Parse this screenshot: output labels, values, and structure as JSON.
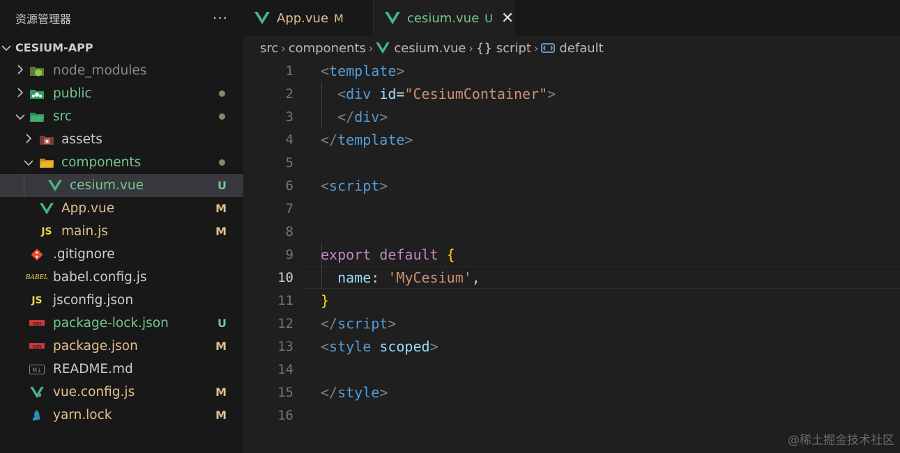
{
  "sidebar": {
    "title": "资源管理器",
    "more": "···",
    "root": {
      "chevron": "⌄",
      "label": "CESIUM-APP"
    },
    "items": [
      {
        "name": "node_modules",
        "kind": "folder",
        "depth": 1,
        "expanded": false,
        "icon": "node-folder-icon",
        "color": "#8b8b8b",
        "status": ""
      },
      {
        "name": "public",
        "kind": "folder",
        "depth": 1,
        "expanded": false,
        "icon": "public-folder-icon",
        "color": "#73c991",
        "status": "dot"
      },
      {
        "name": "src",
        "kind": "folder",
        "depth": 1,
        "expanded": true,
        "icon": "src-folder-icon",
        "color": "#73c991",
        "status": "dot"
      },
      {
        "name": "assets",
        "kind": "folder",
        "depth": 2,
        "expanded": false,
        "icon": "assets-folder-icon",
        "color": "#cccccc",
        "status": ""
      },
      {
        "name": "components",
        "kind": "folder",
        "depth": 2,
        "expanded": true,
        "icon": "components-folder-icon",
        "color": "#73c991",
        "status": "dot"
      },
      {
        "name": "cesium.vue",
        "kind": "file",
        "depth": 3,
        "icon": "vue-icon",
        "color": "#73c991",
        "status": "U",
        "selected": true
      },
      {
        "name": "App.vue",
        "kind": "file",
        "depth": 2,
        "icon": "vue-icon",
        "color": "#e2c08d",
        "status": "M"
      },
      {
        "name": "main.js",
        "kind": "file",
        "depth": 2,
        "icon": "js-icon",
        "color": "#e2c08d",
        "status": "M"
      },
      {
        "name": ".gitignore",
        "kind": "file",
        "depth": 1,
        "icon": "git-icon",
        "color": "#cccccc",
        "status": ""
      },
      {
        "name": "babel.config.js",
        "kind": "file",
        "depth": 1,
        "icon": "babel-icon",
        "color": "#cccccc",
        "status": ""
      },
      {
        "name": "jsconfig.json",
        "kind": "file",
        "depth": 1,
        "icon": "js-icon",
        "color": "#cccccc",
        "status": ""
      },
      {
        "name": "package-lock.json",
        "kind": "file",
        "depth": 1,
        "icon": "npm-icon",
        "color": "#73c991",
        "status": "U"
      },
      {
        "name": "package.json",
        "kind": "file",
        "depth": 1,
        "icon": "npm-icon",
        "color": "#e2c08d",
        "status": "M"
      },
      {
        "name": "README.md",
        "kind": "file",
        "depth": 1,
        "icon": "markdown-icon",
        "color": "#cccccc",
        "status": ""
      },
      {
        "name": "vue.config.js",
        "kind": "file",
        "depth": 1,
        "icon": "vue-config-icon",
        "color": "#e2c08d",
        "status": "M"
      },
      {
        "name": "yarn.lock",
        "kind": "file",
        "depth": 1,
        "icon": "yarn-icon",
        "color": "#e2c08d",
        "status": "M"
      }
    ]
  },
  "tabs": [
    {
      "label": "App.vue",
      "status": "M",
      "active": false
    },
    {
      "label": "cesium.vue",
      "status": "U",
      "active": true,
      "close": "✕"
    }
  ],
  "breadcrumb": {
    "items": [
      "src",
      "components",
      "cesium.vue",
      "script",
      "default"
    ],
    "script_glyph": "{}",
    "separator": "›"
  },
  "editor": {
    "current_line": 10,
    "lines": [
      {
        "n": "1",
        "tokens": [
          [
            "<",
            "pun"
          ],
          [
            "template",
            "tag"
          ],
          [
            ">",
            "pun"
          ]
        ]
      },
      {
        "n": "2",
        "tokens": [
          [
            "  ",
            "plain"
          ],
          [
            "<",
            "pun"
          ],
          [
            "div",
            "tag"
          ],
          [
            " ",
            "plain"
          ],
          [
            "id",
            "attr"
          ],
          [
            "=",
            "plain"
          ],
          [
            "\"CesiumContainer\"",
            "str"
          ],
          [
            ">",
            "pun"
          ]
        ]
      },
      {
        "n": "3",
        "tokens": [
          [
            "  ",
            "plain"
          ],
          [
            "</",
            "pun"
          ],
          [
            "div",
            "tag"
          ],
          [
            ">",
            "pun"
          ]
        ]
      },
      {
        "n": "4",
        "tokens": [
          [
            "</",
            "pun"
          ],
          [
            "template",
            "tag"
          ],
          [
            ">",
            "pun"
          ]
        ]
      },
      {
        "n": "5",
        "tokens": []
      },
      {
        "n": "6",
        "tokens": [
          [
            "<",
            "pun"
          ],
          [
            "script",
            "tag"
          ],
          [
            ">",
            "pun"
          ]
        ]
      },
      {
        "n": "7",
        "tokens": []
      },
      {
        "n": "8",
        "tokens": []
      },
      {
        "n": "9",
        "tokens": [
          [
            "export",
            "kw"
          ],
          [
            " ",
            "plain"
          ],
          [
            "default",
            "kw"
          ],
          [
            " ",
            "plain"
          ],
          [
            "{",
            "brace"
          ]
        ]
      },
      {
        "n": "10",
        "tokens": [
          [
            "  ",
            "plain"
          ],
          [
            "name",
            "attr"
          ],
          [
            ": ",
            "plain"
          ],
          [
            "'MyCesium'",
            "str"
          ],
          [
            ",",
            "plain"
          ]
        ]
      },
      {
        "n": "11",
        "tokens": [
          [
            "}",
            "brace"
          ]
        ]
      },
      {
        "n": "12",
        "tokens": [
          [
            "</",
            "pun"
          ],
          [
            "script",
            "tag"
          ],
          [
            ">",
            "pun"
          ]
        ]
      },
      {
        "n": "13",
        "tokens": [
          [
            "<",
            "pun"
          ],
          [
            "style",
            "tag"
          ],
          [
            " ",
            "plain"
          ],
          [
            "scoped",
            "attr"
          ],
          [
            ">",
            "pun"
          ]
        ]
      },
      {
        "n": "14",
        "tokens": []
      },
      {
        "n": "15",
        "tokens": [
          [
            "</",
            "pun"
          ],
          [
            "style",
            "tag"
          ],
          [
            ">",
            "pun"
          ]
        ]
      },
      {
        "n": "16",
        "tokens": []
      }
    ]
  },
  "watermark": "@稀土掘金技术社区",
  "colors": {
    "vue_green": "#41b883",
    "modified": "#e2c08d",
    "untracked": "#73c991"
  }
}
